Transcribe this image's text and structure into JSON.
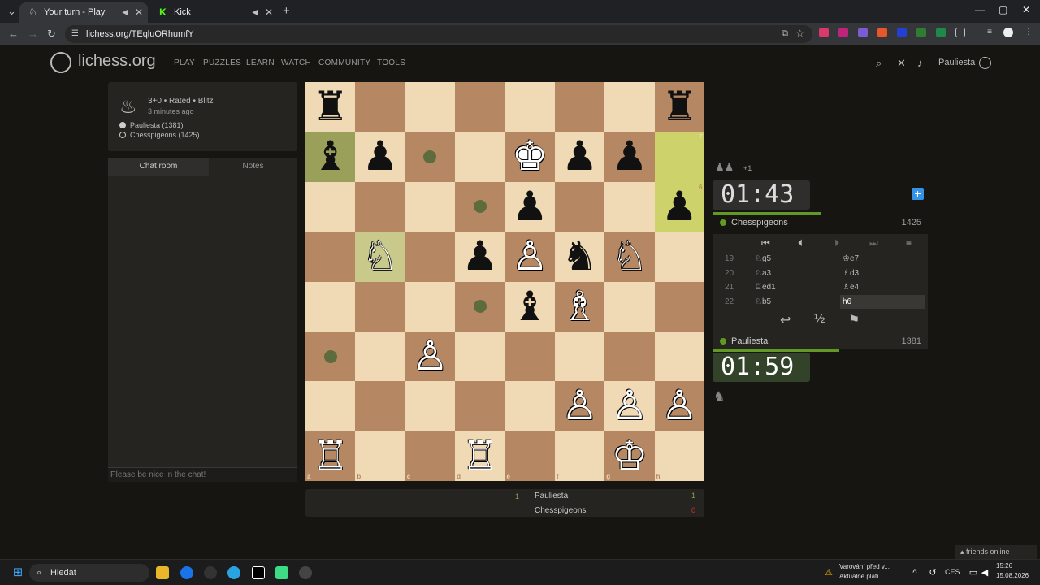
{
  "browser": {
    "tabs": [
      {
        "title": "Your turn - Play Chesspige",
        "active": true
      },
      {
        "title": "Kick",
        "active": false
      }
    ],
    "url": "lichess.org/TEqluORhumfY"
  },
  "site": {
    "logo": "lichess.org",
    "nav": [
      "PLAY",
      "PUZZLES",
      "LEARN",
      "WATCH",
      "COMMUNITY",
      "TOOLS"
    ],
    "username": "Pauliesta"
  },
  "game": {
    "type": "3+0 • Rated • Blitz",
    "time_ago": "3 minutes ago",
    "white": "Pauliesta (1381)",
    "black": "Chesspigeons (1425)"
  },
  "chat": {
    "tabs": [
      "Chat room",
      "Notes"
    ],
    "placeholder": "Please be nice in the chat!"
  },
  "board": {
    "files": [
      "a",
      "b",
      "c",
      "d",
      "e",
      "f",
      "g",
      "h"
    ],
    "ranks": [
      "8",
      "7",
      "6",
      "5",
      "4",
      "3",
      "2",
      "1"
    ]
  },
  "opponent": {
    "name": "Chesspigeons",
    "rating": "1425",
    "clock": "01:43",
    "material": "+1",
    "clock_fraction": 0.5
  },
  "player": {
    "name": "Pauliesta",
    "rating": "1381",
    "clock": "01:59",
    "clock_fraction": 0.59
  },
  "moves": [
    {
      "num": "19",
      "white": "♘g5",
      "black": "♔e7"
    },
    {
      "num": "20",
      "white": "♘a3",
      "black": "♗d3"
    },
    {
      "num": "21",
      "white": "♖ed1",
      "black": "♗e4"
    },
    {
      "num": "22",
      "white": "♘b5",
      "black": "h6"
    }
  ],
  "score": {
    "round": "1",
    "p1": "Pauliesta",
    "p1_score": "1",
    "p2": "Chesspigeons",
    "p2_score": "0"
  },
  "friends": "friends online",
  "taskbar": {
    "search": "Hledat",
    "warning_line1": "Varování před v...",
    "warning_line2": "Aktuálně platí",
    "lang": "CES",
    "time": "15:26",
    "date": "15.08.2026"
  }
}
